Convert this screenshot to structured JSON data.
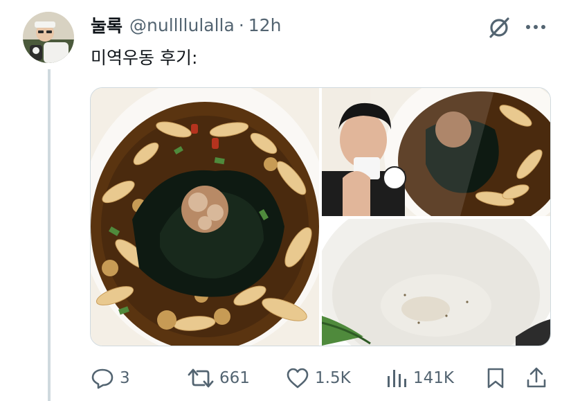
{
  "tweet": {
    "display_name": "눌록",
    "handle": "@nullllulalla",
    "separator": "·",
    "time": "12h",
    "text": "미역우동 후기:"
  },
  "media": {
    "images": [
      {
        "name": "udon-bowl-photo"
      },
      {
        "name": "man-eating-photo"
      },
      {
        "name": "empty-bowl-photo"
      }
    ]
  },
  "actions": {
    "reply": {
      "icon": "reply-icon",
      "count": "3"
    },
    "retweet": {
      "icon": "retweet-icon",
      "count": "661"
    },
    "like": {
      "icon": "heart-icon",
      "count": "1.5K"
    },
    "views": {
      "icon": "views-icon",
      "count": "141K"
    },
    "bookmark": {
      "icon": "bookmark-icon"
    },
    "share": {
      "icon": "share-icon"
    }
  },
  "colors": {
    "text_primary": "#0f1419",
    "text_secondary": "#536471",
    "thread_line": "#cfd9de",
    "broth": "#4a2a0e",
    "seaweed": "#0e1a12"
  }
}
